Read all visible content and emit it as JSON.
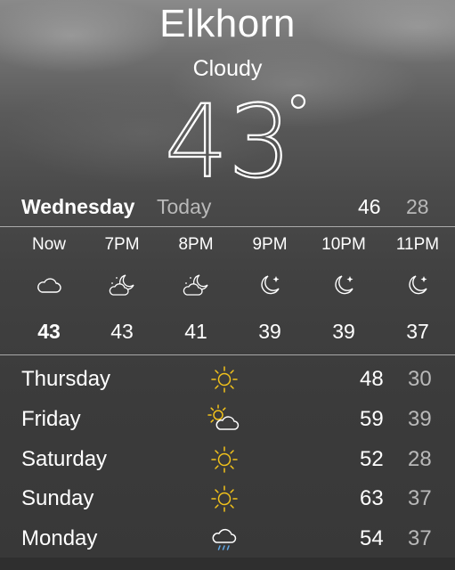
{
  "location": {
    "city": "Elkhorn",
    "condition": "Cloudy",
    "temperature": "43",
    "degree_symbol": "°"
  },
  "today": {
    "day": "Wednesday",
    "label": "Today",
    "high": "46",
    "low": "28"
  },
  "hourly": [
    {
      "time": "Now",
      "icon": "cloud-icon",
      "temp": "43"
    },
    {
      "time": "7PM",
      "icon": "partly-cloudy-night-icon",
      "temp": "43"
    },
    {
      "time": "8PM",
      "icon": "partly-cloudy-night-icon",
      "temp": "41"
    },
    {
      "time": "9PM",
      "icon": "clear-night-icon",
      "temp": "39"
    },
    {
      "time": "10PM",
      "icon": "clear-night-icon",
      "temp": "39"
    },
    {
      "time": "11PM",
      "icon": "clear-night-icon",
      "temp": "37"
    }
  ],
  "daily": [
    {
      "day": "Thursday",
      "icon": "sun-icon",
      "high": "48",
      "low": "30"
    },
    {
      "day": "Friday",
      "icon": "partly-sunny-icon",
      "high": "59",
      "low": "39"
    },
    {
      "day": "Saturday",
      "icon": "sun-icon",
      "high": "52",
      "low": "28"
    },
    {
      "day": "Sunday",
      "icon": "sun-icon",
      "high": "63",
      "low": "37"
    },
    {
      "day": "Monday",
      "icon": "rain-icon",
      "high": "54",
      "low": "37"
    }
  ],
  "colors": {
    "sun": "#f2c21b",
    "rain": "#5fa8e6",
    "secondary_text": "#b9b9b9"
  }
}
